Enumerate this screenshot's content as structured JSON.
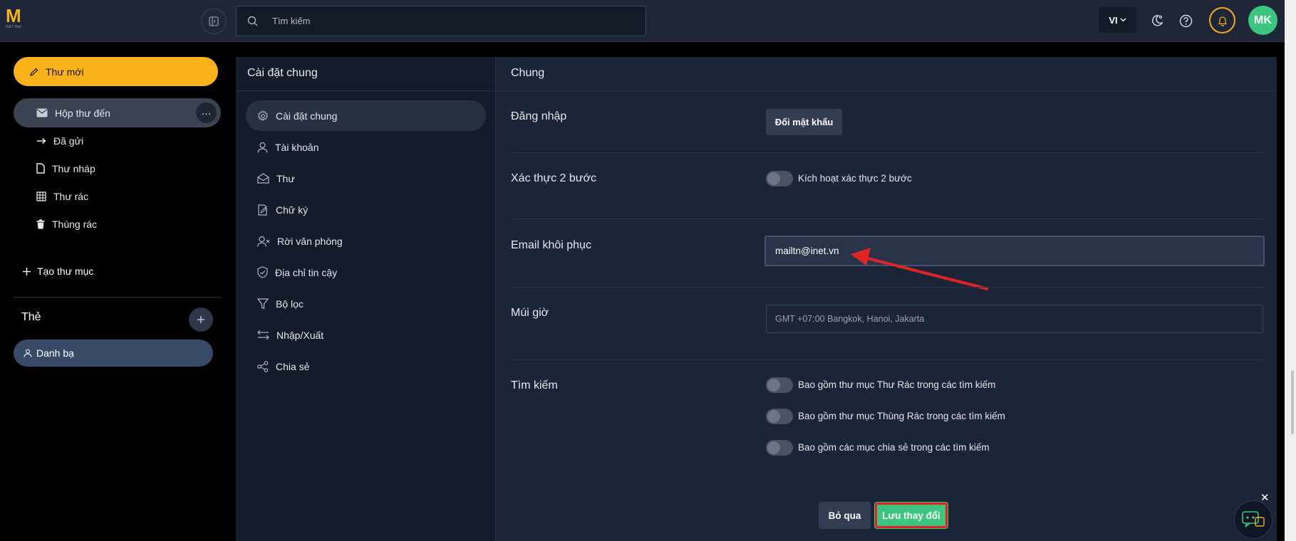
{
  "topbar": {
    "logo_letter": "M",
    "logo_sub": "iNET Mail",
    "search_placeholder": "Tìm kiếm",
    "language": "VI",
    "avatar_initials": "MK"
  },
  "leftnav": {
    "compose_label": "Thư mới",
    "items": [
      {
        "label": "Hộp thư đến",
        "icon": "mail-icon"
      },
      {
        "label": "Đã gửi",
        "icon": "arrow-right-icon"
      },
      {
        "label": "Thư nháp",
        "icon": "document-icon"
      },
      {
        "label": "Thư rác",
        "icon": "spam-icon"
      },
      {
        "label": "Thùng rác",
        "icon": "trash-icon"
      }
    ],
    "more_label": "···",
    "new_folder_label": "Tạo thư mục",
    "tags_title": "Thẻ",
    "tag_item": "Danh bạ"
  },
  "settings_nav": {
    "title": "Cài đặt chung",
    "items": [
      {
        "label": "Cài đặt chung",
        "icon": "gear-icon"
      },
      {
        "label": "Tài khoản",
        "icon": "user-icon"
      },
      {
        "label": "Thư",
        "icon": "mail-open-icon"
      },
      {
        "label": "Chữ ký",
        "icon": "signature-icon"
      },
      {
        "label": "Rời văn phòng",
        "icon": "user-x-icon"
      },
      {
        "label": "Địa chỉ tin cậy",
        "icon": "shield-icon"
      },
      {
        "label": "Bộ lọc",
        "icon": "filter-icon"
      },
      {
        "label": "Nhập/Xuất",
        "icon": "import-export-icon"
      },
      {
        "label": "Chia sẻ",
        "icon": "share-icon"
      }
    ]
  },
  "main": {
    "title": "Chung",
    "login_label": "Đăng nhập",
    "change_password_button": "Đổi mật khẩu",
    "twofa_label": "Xác thực 2 bước",
    "twofa_toggle_label": "Kích hoạt xác thực 2 bước",
    "recovery_label": "Email khôi phục",
    "recovery_value": "mailtn@inet.vn",
    "timezone_label": "Múi giờ",
    "timezone_value": "GMT +07:00 Bangkok, Hanoi, Jakarta",
    "search_label": "Tìm kiếm",
    "search_options": [
      "Bao gồm thư mục Thư Rác trong các tìm kiếm",
      "Bao gồm thư mục Thùng Rác trong các tìm kiếm",
      "Bao gồm các mục chia sẻ trong các tìm kiếm"
    ],
    "cancel_button": "Bỏ qua",
    "save_button": "Lưu thay đổi"
  },
  "colors": {
    "accent": "#f9b21a",
    "save": "#3cc57f",
    "highlight": "#e02424"
  }
}
